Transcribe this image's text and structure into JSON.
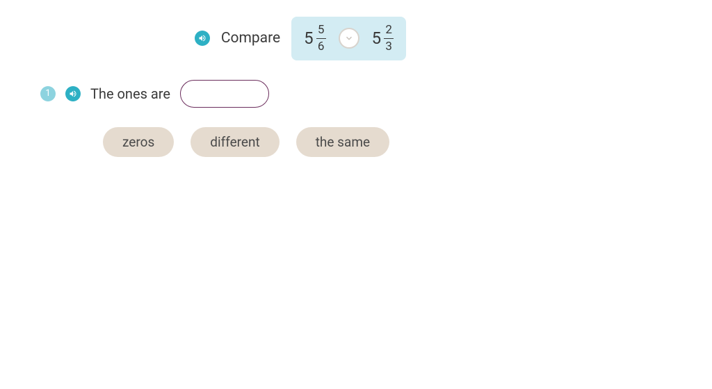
{
  "header": {
    "compare_label": "Compare",
    "left": {
      "whole": "5",
      "numerator": "5",
      "denominator": "6"
    },
    "right": {
      "whole": "5",
      "numerator": "2",
      "denominator": "3"
    }
  },
  "step": {
    "number": "1",
    "text": "The ones are"
  },
  "options": {
    "a": "zeros",
    "b": "different",
    "c": "the same"
  }
}
